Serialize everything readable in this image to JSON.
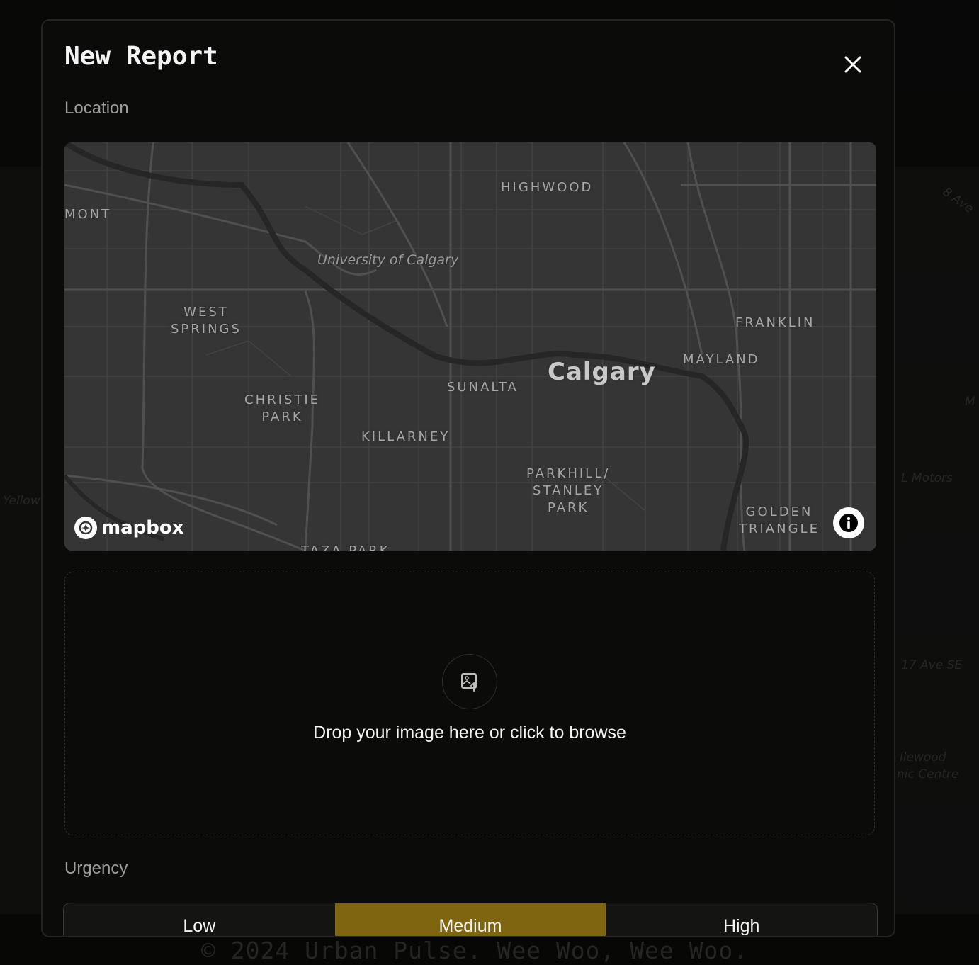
{
  "background": {
    "map_labels": [
      "8 Ave",
      "Yellow",
      "M",
      "L Motors",
      "17 Ave SE",
      "llewood",
      "nic Centre"
    ],
    "footer_text": "© 2024 Urban Pulse. Wee Woo, Wee Woo."
  },
  "modal": {
    "title": "New Report",
    "close_icon": "close-icon",
    "location_label": "Location",
    "map": {
      "labels": {
        "mont": "MONT",
        "highwood": "HIGHWOOD",
        "university": "University of Calgary",
        "west_springs": "WEST\nSPRINGS",
        "franklin": "FRANKLIN",
        "mayland": "MAYLAND",
        "sunalta": "SUNALTA",
        "calgary": "Calgary",
        "christie_park": "CHRISTIE\nPARK",
        "killarney": "KILLARNEY",
        "parkhill": "PARKHILL/\nSTANLEY\nPARK",
        "golden_triangle": "GOLDEN\nTRIANGLE",
        "taza_park": "TAZA PARK"
      },
      "attribution_logo": "mapbox",
      "info_icon": "info-icon"
    },
    "dropzone": {
      "icon": "image-upload-icon",
      "text": "Drop your image here or click to browse"
    },
    "urgency_label": "Urgency",
    "urgency_options": [
      "Low",
      "Medium",
      "High"
    ],
    "urgency_selected": "Medium",
    "accent_color": "#7f6510"
  }
}
